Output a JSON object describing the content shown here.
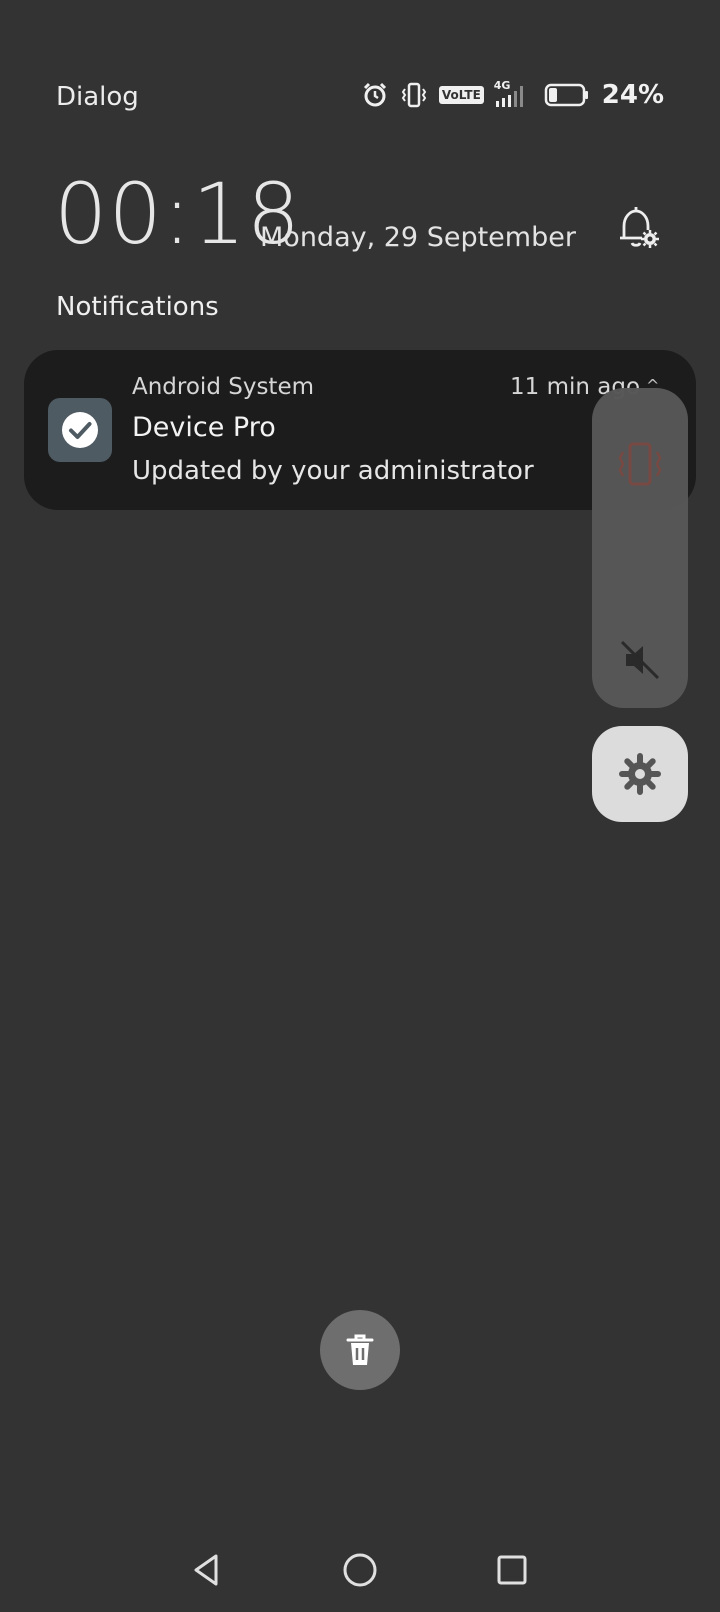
{
  "status_bar": {
    "carrier": "Dialog",
    "icons": [
      "alarm-icon",
      "vibrate-icon",
      "volte-icon",
      "4g-signal-icon",
      "battery-icon"
    ],
    "volte_label": "VoLTE",
    "network_label": "4G",
    "battery_percent": "24%",
    "battery_level": 0.24
  },
  "header": {
    "time": "00:18",
    "date": "Monday, 29 September",
    "bell_settings_icon": "bell-settings-icon"
  },
  "notifications_title": "Notifications",
  "notification": {
    "source": "Android System",
    "time_ago": "11 min ago",
    "title": "Device Pro",
    "body": "Updated by your administrator",
    "app_icon": "check-circle-icon"
  },
  "volume_panel": {
    "icons": [
      "vibrate-icon",
      "volume-mute-icon",
      "settings-gear-icon"
    ]
  },
  "clear_all_icon": "trash-icon",
  "nav": {
    "icons": [
      "back-icon",
      "home-icon",
      "recents-icon"
    ]
  },
  "colors": {
    "background": "#333333",
    "card": "#1c1c1c",
    "app_icon_bg": "#4f5b63",
    "volume_panel": "#575757",
    "vibrate_accent": "#7a4a44"
  }
}
